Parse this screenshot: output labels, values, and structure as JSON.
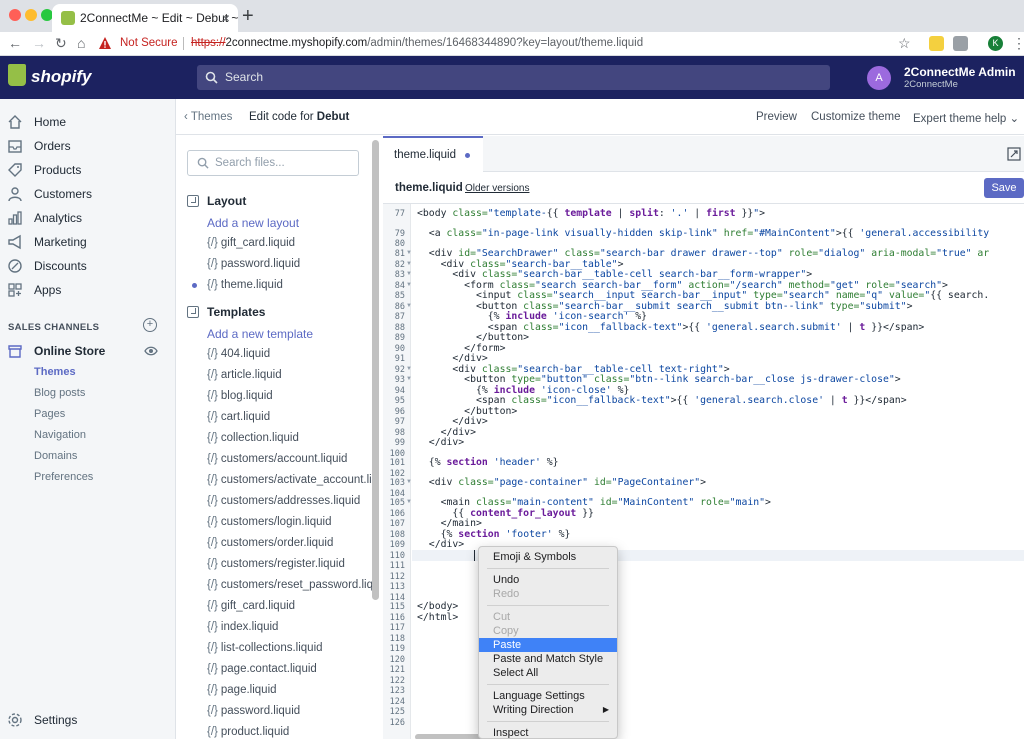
{
  "browser": {
    "tab_title": "2ConnectMe ~ Edit ~ Debut ~",
    "tab_close": "×",
    "new_tab": "+",
    "not_secure": "Not Secure",
    "url_scheme": "https://",
    "url_host": "2connectme.myshopify.com",
    "url_path": "/admin/themes/16468344890?key=layout/theme.liquid",
    "profile_initial": "K"
  },
  "topbar": {
    "logo": "shopify",
    "search_placeholder": "Search",
    "avatar_initial": "A",
    "store_name": "2ConnectMe Admin",
    "store_sub": "2ConnectMe"
  },
  "nav": {
    "items": [
      {
        "label": "Home",
        "icon": "home-icon"
      },
      {
        "label": "Orders",
        "icon": "orders-icon"
      },
      {
        "label": "Products",
        "icon": "products-icon"
      },
      {
        "label": "Customers",
        "icon": "customers-icon"
      },
      {
        "label": "Analytics",
        "icon": "analytics-icon"
      },
      {
        "label": "Marketing",
        "icon": "marketing-icon"
      },
      {
        "label": "Discounts",
        "icon": "discounts-icon"
      },
      {
        "label": "Apps",
        "icon": "apps-icon"
      }
    ],
    "sales_channels_title": "SALES CHANNELS",
    "online_store": "Online Store",
    "sub_items": [
      "Themes",
      "Blog posts",
      "Pages",
      "Navigation",
      "Domains",
      "Preferences"
    ],
    "settings": "Settings"
  },
  "editor_header": {
    "back": "Themes",
    "title_prefix": "Edit code for",
    "theme_name": "Debut",
    "preview": "Preview",
    "customize": "Customize theme",
    "help": "Expert theme help"
  },
  "files": {
    "search_placeholder": "Search files...",
    "layout_title": "Layout",
    "add_layout": "Add a new layout",
    "layout_files": [
      "gift_card.liquid",
      "password.liquid",
      "theme.liquid"
    ],
    "templates_title": "Templates",
    "add_template": "Add a new template",
    "template_files": [
      "404.liquid",
      "article.liquid",
      "blog.liquid",
      "cart.liquid",
      "collection.liquid",
      "customers/account.liquid",
      "customers/activate_account.li",
      "customers/addresses.liquid",
      "customers/login.liquid",
      "customers/order.liquid",
      "customers/register.liquid",
      "customers/reset_password.liq",
      "gift_card.liquid",
      "index.liquid",
      "list-collections.liquid",
      "page.contact.liquid",
      "page.liquid",
      "password.liquid",
      "product.liquid"
    ],
    "file_icon": "{/}"
  },
  "code_editor": {
    "tab_name": "theme.liquid",
    "file_title": "theme.liquid",
    "older_versions": "Older versions",
    "save": "Save",
    "line_numbers": [
      "77",
      "79",
      "80",
      "81",
      "82",
      "83",
      "84",
      "85",
      "86",
      "87",
      "88",
      "89",
      "90",
      "91",
      "92",
      "93",
      "94",
      "95",
      "96",
      "97",
      "98",
      "99",
      "100",
      "101",
      "102",
      "103",
      "104",
      "105",
      "106",
      "107",
      "108",
      "109",
      "110",
      "111",
      "112",
      "113",
      "114",
      "115",
      "116",
      "117",
      "118",
      "119",
      "120",
      "121",
      "122",
      "123",
      "124",
      "125",
      "126"
    ]
  },
  "context_menu": {
    "items": [
      "Emoji & Symbols",
      "Undo",
      "Redo",
      "Cut",
      "Copy",
      "Paste",
      "Paste and Match Style",
      "Select All",
      "Language Settings",
      "Writing Direction",
      "Inspect"
    ],
    "highlighted": "Paste"
  }
}
